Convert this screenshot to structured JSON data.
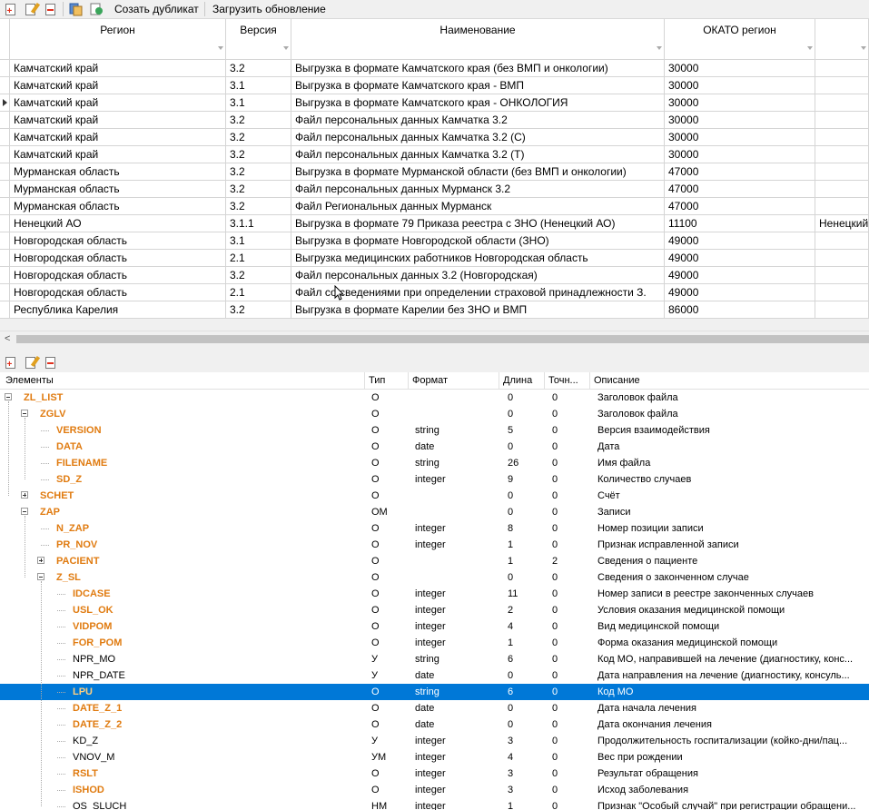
{
  "toolbar": {
    "icons": [
      "add-icon",
      "edit-icon",
      "delete-icon",
      "copy-icon",
      "refresh-icon"
    ],
    "duplicate_label": "Созать дубликат",
    "update_label": "Загрузить обновление"
  },
  "grid": {
    "columns": [
      "Регион",
      "Версия",
      "Наименование",
      "ОКАТО регион"
    ],
    "rows": [
      {
        "region": "Камчатский край",
        "version": "3.2",
        "name": "Выгрузка в формате Камчатского края (без ВМП и онкологии)",
        "okato": "30000",
        "extra": ""
      },
      {
        "region": "Камчатский край",
        "version": "3.1",
        "name": "Выгрузка в формате Камчатского края - ВМП",
        "okato": "30000",
        "extra": ""
      },
      {
        "region": "Камчатский край",
        "version": "3.1",
        "name": "Выгрузка в формате Камчатского края - ОНКОЛОГИЯ",
        "okato": "30000",
        "extra": ""
      },
      {
        "region": "Камчатский край",
        "version": "3.2",
        "name": "Файл персональных данных Камчатка 3.2",
        "okato": "30000",
        "extra": ""
      },
      {
        "region": "Камчатский край",
        "version": "3.2",
        "name": "Файл персональных данных Камчатка 3.2 (С)",
        "okato": "30000",
        "extra": ""
      },
      {
        "region": "Камчатский край",
        "version": "3.2",
        "name": "Файл персональных данных Камчатка 3.2 (Т)",
        "okato": "30000",
        "extra": ""
      },
      {
        "region": "Мурманская область",
        "version": "3.2",
        "name": "Выгрузка в формате Мурманской области (без ВМП и онкологии)",
        "okato": "47000",
        "extra": ""
      },
      {
        "region": "Мурманская область",
        "version": "3.2",
        "name": "Файл персональных данных Мурманск 3.2",
        "okato": "47000",
        "extra": ""
      },
      {
        "region": "Мурманская область",
        "version": "3.2",
        "name": "Файл Региональных данных Мурманск",
        "okato": "47000",
        "extra": ""
      },
      {
        "region": "Ненецкий АО",
        "version": "3.1.1",
        "name": "Выгрузка в формате 79 Приказа реестра с ЗНО (Ненецкий АО)",
        "okato": "11100",
        "extra": "Ненецкий"
      },
      {
        "region": "Новгородская область",
        "version": "3.1",
        "name": "Выгрузка в формате Новгородской области (ЗНО)",
        "okato": "49000",
        "extra": ""
      },
      {
        "region": "Новгородская область",
        "version": "2.1",
        "name": "Выгрузка медицинских работников Новгородская область",
        "okato": "49000",
        "extra": ""
      },
      {
        "region": "Новгородская область",
        "version": "3.2",
        "name": "Файл персональных данных 3.2 (Новгородская)",
        "okato": "49000",
        "extra": ""
      },
      {
        "region": "Новгородская область",
        "version": "2.1",
        "name": "Файл со сведениями при определении страховой принадлежности З.",
        "okato": "49000",
        "extra": ""
      },
      {
        "region": "Республика Карелия",
        "version": "3.2",
        "name": "Выгрузка в формате Карелии без ЗНО и ВМП",
        "okato": "86000",
        "extra": ""
      }
    ]
  },
  "tree": {
    "columns": [
      "Элементы",
      "Тип",
      "Формат",
      "Длина",
      "Точн...",
      "Описание"
    ],
    "rows": [
      {
        "name": "ZL_LIST",
        "bold": true,
        "depth": 0,
        "exp": "minus",
        "type": "О",
        "format": "",
        "len": "0",
        "prec": "0",
        "desc": "Заголовок файла"
      },
      {
        "name": "ZGLV",
        "bold": true,
        "depth": 1,
        "exp": "minus",
        "type": "О",
        "format": "",
        "len": "0",
        "prec": "0",
        "desc": "Заголовок файла"
      },
      {
        "name": "VERSION",
        "bold": true,
        "depth": 2,
        "exp": "",
        "type": "О",
        "format": "string",
        "len": "5",
        "prec": "0",
        "desc": "Версия взаимодействия"
      },
      {
        "name": "DATA",
        "bold": true,
        "depth": 2,
        "exp": "",
        "type": "О",
        "format": "date",
        "len": "0",
        "prec": "0",
        "desc": "Дата"
      },
      {
        "name": "FILENAME",
        "bold": true,
        "depth": 2,
        "exp": "",
        "type": "О",
        "format": "string",
        "len": "26",
        "prec": "0",
        "desc": "Имя файла"
      },
      {
        "name": "SD_Z",
        "bold": true,
        "depth": 2,
        "exp": "",
        "type": "О",
        "format": "integer",
        "len": "9",
        "prec": "0",
        "desc": "Количество случаев"
      },
      {
        "name": "SCHET",
        "bold": true,
        "depth": 1,
        "exp": "plus",
        "type": "О",
        "format": "",
        "len": "0",
        "prec": "0",
        "desc": "Счёт"
      },
      {
        "name": "ZAP",
        "bold": true,
        "depth": 1,
        "exp": "minus",
        "type": "ОМ",
        "format": "",
        "len": "0",
        "prec": "0",
        "desc": "Записи"
      },
      {
        "name": "N_ZAP",
        "bold": true,
        "depth": 2,
        "exp": "",
        "type": "О",
        "format": "integer",
        "len": "8",
        "prec": "0",
        "desc": "Номер позиции записи"
      },
      {
        "name": "PR_NOV",
        "bold": true,
        "depth": 2,
        "exp": "",
        "type": "О",
        "format": "integer",
        "len": "1",
        "prec": "0",
        "desc": "Признак исправленной записи"
      },
      {
        "name": "PACIENT",
        "bold": true,
        "depth": 2,
        "exp": "plus",
        "type": "О",
        "format": "",
        "len": "1",
        "prec": "2",
        "desc": "Сведения о пациенте"
      },
      {
        "name": "Z_SL",
        "bold": true,
        "depth": 2,
        "exp": "minus",
        "type": "О",
        "format": "",
        "len": "0",
        "prec": "0",
        "desc": "Сведения о законченном случае"
      },
      {
        "name": "IDCASE",
        "bold": true,
        "depth": 3,
        "exp": "",
        "type": "О",
        "format": "integer",
        "len": "11",
        "prec": "0",
        "desc": "Номер записи в реестре законченных случаев"
      },
      {
        "name": "USL_OK",
        "bold": true,
        "depth": 3,
        "exp": "",
        "type": "О",
        "format": "integer",
        "len": "2",
        "prec": "0",
        "desc": "Условия оказания медицинской помощи"
      },
      {
        "name": "VIDPOM",
        "bold": true,
        "depth": 3,
        "exp": "",
        "type": "О",
        "format": "integer",
        "len": "4",
        "prec": "0",
        "desc": "Вид медицинской помощи"
      },
      {
        "name": "FOR_POM",
        "bold": true,
        "depth": 3,
        "exp": "",
        "type": "О",
        "format": "integer",
        "len": "1",
        "prec": "0",
        "desc": "Форма оказания медицинской помощи"
      },
      {
        "name": "NPR_MO",
        "bold": false,
        "depth": 3,
        "exp": "",
        "type": "У",
        "format": "string",
        "len": "6",
        "prec": "0",
        "desc": "Код МО, направившей на лечение (диагностику, конс..."
      },
      {
        "name": "NPR_DATE",
        "bold": false,
        "depth": 3,
        "exp": "",
        "type": "У",
        "format": "date",
        "len": "0",
        "prec": "0",
        "desc": "Дата направления на лечение (диагностику, консуль..."
      },
      {
        "name": "LPU",
        "bold": true,
        "depth": 3,
        "exp": "",
        "type": "О",
        "format": "string",
        "len": "6",
        "prec": "0",
        "desc": "Код МО",
        "selected": true
      },
      {
        "name": "DATE_Z_1",
        "bold": true,
        "depth": 3,
        "exp": "",
        "type": "О",
        "format": "date",
        "len": "0",
        "prec": "0",
        "desc": "Дата начала лечения"
      },
      {
        "name": "DATE_Z_2",
        "bold": true,
        "depth": 3,
        "exp": "",
        "type": "О",
        "format": "date",
        "len": "0",
        "prec": "0",
        "desc": "Дата окончания лечения"
      },
      {
        "name": "KD_Z",
        "bold": false,
        "depth": 3,
        "exp": "",
        "type": "У",
        "format": "integer",
        "len": "3",
        "prec": "0",
        "desc": "Продолжительность госпитализации (койко-дни/пац..."
      },
      {
        "name": "VNOV_M",
        "bold": false,
        "depth": 3,
        "exp": "",
        "type": "УМ",
        "format": "integer",
        "len": "4",
        "prec": "0",
        "desc": "Вес при рождении"
      },
      {
        "name": "RSLT",
        "bold": true,
        "depth": 3,
        "exp": "",
        "type": "О",
        "format": "integer",
        "len": "3",
        "prec": "0",
        "desc": "Результат обращения"
      },
      {
        "name": "ISHOD",
        "bold": true,
        "depth": 3,
        "exp": "",
        "type": "О",
        "format": "integer",
        "len": "3",
        "prec": "0",
        "desc": "Исход заболевания"
      },
      {
        "name": "OS_SLUCH",
        "bold": false,
        "depth": 3,
        "exp": "",
        "type": "НМ",
        "format": "integer",
        "len": "1",
        "prec": "0",
        "desc": "Признак \"Особый случай\" при регистрации обращени..."
      }
    ]
  },
  "colors": {
    "selection": "#0078d7",
    "element_name": "#e07b10"
  }
}
